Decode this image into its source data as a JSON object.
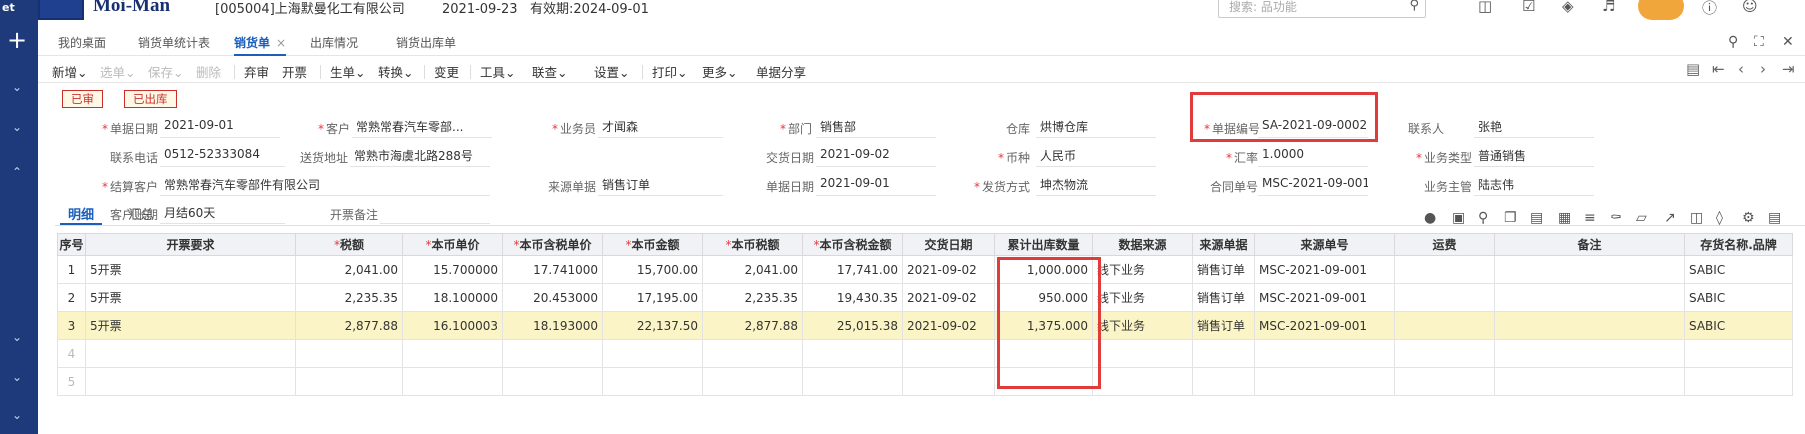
{
  "sidebar": {
    "brand_fragment": "et",
    "plus": "+"
  },
  "topbar": {
    "app_name": "Moi-Man",
    "company": "[005004]上海默曼化工有限公司",
    "date": "2021-09-23",
    "validity": "有效期:2024-09-01",
    "search_placeholder": "搜索: 品功能"
  },
  "tabs": [
    {
      "label": "我的桌面"
    },
    {
      "label": "销货单统计表"
    },
    {
      "label": "销货单",
      "close": "×"
    },
    {
      "label": "出库情况"
    },
    {
      "label": "销货出库单"
    }
  ],
  "toolbar": {
    "items": [
      "新增⌄",
      "选单⌄",
      "保存⌄",
      "删除",
      "弃审",
      "开票",
      "生单⌄",
      "转换⌄",
      "变更",
      "工具⌄",
      "联查⌄",
      "设置⌄",
      "打印⌄",
      "更多⌄",
      "单据分享"
    ]
  },
  "status": [
    "已审",
    "已出库"
  ],
  "form": {
    "bill_date": {
      "label": "单据日期",
      "value": "2021-09-01"
    },
    "customer": {
      "label": "客户",
      "value": "常熟常春汽车零部..."
    },
    "salesman": {
      "label": "业务员",
      "value": "才闻森"
    },
    "dept": {
      "label": "部门",
      "value": "销售部"
    },
    "warehouse": {
      "label": "仓库",
      "value": "烘博仓库"
    },
    "bill_no": {
      "label": "单据编号",
      "value": "SA-2021-09-0002"
    },
    "contact": {
      "label": "联系人",
      "value": "张艳"
    },
    "phone": {
      "label": "联系电话",
      "value": "0512-52333084"
    },
    "address": {
      "label": "送货地址",
      "value": "常熟市海虞北路288号"
    },
    "delivery_date": {
      "label": "交货日期",
      "value": "2021-09-02"
    },
    "currency": {
      "label": "币种",
      "value": "人民币"
    },
    "rate": {
      "label": "汇率",
      "value": "1.0000"
    },
    "biz_type": {
      "label": "业务类型",
      "value": "普通销售"
    },
    "settle_cust": {
      "label": "结算客户",
      "value": "常熟常春汽车零部件有限公司"
    },
    "source_bill": {
      "label": "来源单据",
      "value": "销售订单"
    },
    "bill_date2": {
      "label": "单据日期",
      "value": "2021-09-01"
    },
    "ship_method": {
      "label": "发货方式",
      "value": "坤杰物流"
    },
    "contract_no": {
      "label": "合同单号",
      "value": "MSC-2021-09-001"
    },
    "supervisor": {
      "label": "业务主管",
      "value": "陆志伟"
    },
    "account_period": {
      "label": "客户账期",
      "value": "月结60天"
    },
    "invoice_note": {
      "label": "开票备注",
      "value": ""
    }
  },
  "subtabs": [
    "明细",
    "汇总"
  ],
  "grid": {
    "headers": [
      {
        "label": "序号",
        "req": ""
      },
      {
        "label": "开票要求",
        "req": ""
      },
      {
        "label": "税额",
        "req": "*"
      },
      {
        "label": "本币单价",
        "req": "*"
      },
      {
        "label": "本币含税单价",
        "req": "*"
      },
      {
        "label": "本币金额",
        "req": "*"
      },
      {
        "label": "本币税额",
        "req": "*"
      },
      {
        "label": "本币含税金额",
        "req": "*"
      },
      {
        "label": "交货日期",
        "req": ""
      },
      {
        "label": "累计出库数量",
        "req": ""
      },
      {
        "label": "数据来源",
        "req": ""
      },
      {
        "label": "来源单据",
        "req": ""
      },
      {
        "label": "来源单号",
        "req": ""
      },
      {
        "label": "运费",
        "req": ""
      },
      {
        "label": "备注",
        "req": ""
      },
      {
        "label": "存货名称.品牌",
        "req": ""
      }
    ],
    "rows": [
      [
        "1",
        "5开票",
        "2,041.00",
        "15.700000",
        "17.741000",
        "15,700.00",
        "2,041.00",
        "17,741.00",
        "2021-09-02",
        "1,000.000",
        "线下业务",
        "销售订单",
        "MSC-2021-09-001",
        "",
        "",
        "SABIC"
      ],
      [
        "2",
        "5开票",
        "2,235.35",
        "18.100000",
        "20.453000",
        "17,195.00",
        "2,235.35",
        "19,430.35",
        "2021-09-02",
        "950.000",
        "线下业务",
        "销售订单",
        "MSC-2021-09-001",
        "",
        "",
        "SABIC"
      ],
      [
        "3",
        "5开票",
        "2,877.88",
        "16.100003",
        "18.193000",
        "22,137.50",
        "2,877.88",
        "25,015.38",
        "2021-09-02",
        "1,375.000",
        "线下业务",
        "销售订单",
        "MSC-2021-09-001",
        "",
        "",
        "SABIC"
      ],
      [
        "4",
        "",
        "",
        "",
        "",
        "",
        "",
        "",
        "",
        "",
        "",
        "",
        "",
        "",
        "",
        ""
      ],
      [
        "5",
        "",
        "",
        "",
        "",
        "",
        "",
        "",
        "",
        "",
        "",
        "",
        "",
        "",
        "",
        ""
      ]
    ]
  }
}
